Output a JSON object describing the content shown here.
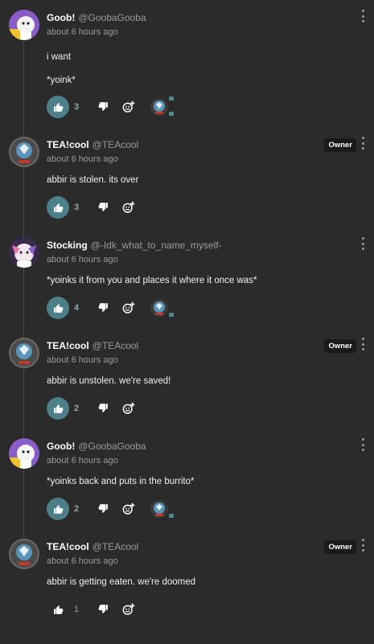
{
  "colors": {
    "background": "#2b2b2b",
    "accent": "#4c7f88",
    "text": "#f0f0f0",
    "muted": "#9a9a9a"
  },
  "comments": [
    {
      "name": "Goob!",
      "handle": "@GoobaGooba",
      "time": "about 6 hours ago",
      "owner": false,
      "lines": [
        "i want",
        "*yoink*"
      ],
      "likes": "3",
      "liked": true,
      "reaction": true
    },
    {
      "name": "TEA!cool",
      "handle": "@TEAcool",
      "time": "about 6 hours ago",
      "owner": true,
      "badge": "Owner",
      "lines": [
        "abbir is stolen. its over"
      ],
      "likes": "3",
      "liked": true,
      "reaction": false
    },
    {
      "name": "Stocking",
      "handle": "@-Idk_what_to_name_myself-",
      "time": "about 6 hours ago",
      "owner": false,
      "lines": [
        "*yoinks it from you and places it where it once was*"
      ],
      "likes": "4",
      "liked": true,
      "reaction": true
    },
    {
      "name": "TEA!cool",
      "handle": "@TEAcool",
      "time": "about 6 hours ago",
      "owner": true,
      "badge": "Owner",
      "lines": [
        "abbir is unstolen. we're saved!"
      ],
      "likes": "2",
      "liked": true,
      "reaction": false
    },
    {
      "name": "Goob!",
      "handle": "@GoobaGooba",
      "time": "about 6 hours ago",
      "owner": false,
      "lines": [
        "*yoinks back and puts in the burrito*"
      ],
      "likes": "2",
      "liked": true,
      "reaction": true
    },
    {
      "name": "TEA!cool",
      "handle": "@TEAcool",
      "time": "about 6 hours ago",
      "owner": true,
      "badge": "Owner",
      "lines": [
        "abbir is getting eaten. we're doomed"
      ],
      "likes": "1",
      "liked": false,
      "reaction": false
    }
  ],
  "icons": {
    "like": "thumbs-up-icon",
    "dislike": "thumbs-down-icon",
    "react": "add-reaction-icon",
    "menu": "kebab-menu-icon"
  }
}
